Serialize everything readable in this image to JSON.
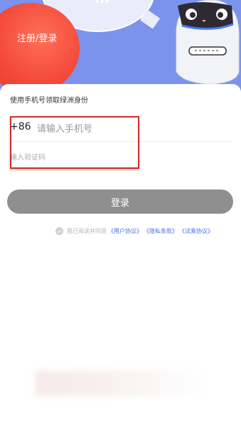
{
  "header": {
    "title": "注册/登录"
  },
  "form": {
    "subtitle": "使用手机号领取绿洲身份",
    "country_code": "+86",
    "phone_placeholder": "请输入手机号",
    "code_placeholder": "输入验证码",
    "login_label": "登录"
  },
  "agreement": {
    "prefix": "我已阅读并同意",
    "links": [
      "《用户协议》",
      "《隐私条款》",
      "《试乘协议》"
    ]
  },
  "colors": {
    "hero_bg": "#7b93ea",
    "red_circle": "#f4493a",
    "highlight_box": "#d22b2b",
    "button_disabled": "#8f8f8f",
    "link": "#4a6fe3"
  },
  "icons": [
    "robot-mascot-icon",
    "speech-bubble-icon",
    "check-circle-icon"
  ]
}
